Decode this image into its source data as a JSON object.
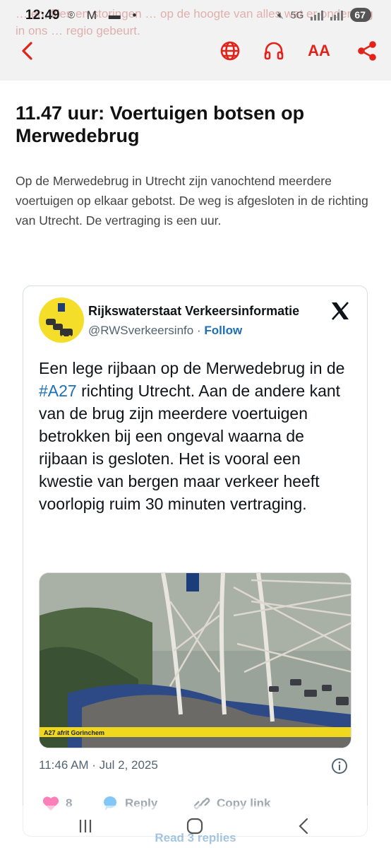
{
  "status_bar": {
    "time": "12:49",
    "network": "5G",
    "battery": "67"
  },
  "header": {
    "behind_text": "… en, files en storingen … op de hoogte van alles wat er onderweg in ons … regio gebeurt.",
    "icons": [
      "back-arrow-icon",
      "globe-icon",
      "headphones-icon",
      "font-size-icon",
      "share-icon"
    ],
    "font_size_label": "AA",
    "accent_color": "#e2231a"
  },
  "article": {
    "title": "11.47 uur: Voertuigen botsen op Merwedebrug",
    "body": "Op de Merwedebrug in Utrecht zijn vanochtend meerdere voertuigen op elkaar gebotst. De weg is afgesloten in de richting van Utrecht. De vertraging is een uur."
  },
  "tweet": {
    "author_name": "Rijkswaterstaat Verkeersinformatie",
    "handle": "@RWSverkeersinfo",
    "separator": "·",
    "follow_label": "Follow",
    "text_before": "Een lege rijbaan op de Merwedebrug in de ",
    "hashtag": "#A27",
    "text_after": " richting Utrecht. Aan de andere kant van de brug zijn meerdere voertuigen betrokken bij een ongeval waarna de rijbaan is gesloten. Het is vooral een kwestie van bergen maar verkeer heeft voorlopig ruim 30 minuten vertraging.",
    "image_caption": "A27 afrit Gorinchem",
    "timestamp": "11:46 AM · Jul 2, 2025",
    "likes": "8",
    "reply_label": "Reply",
    "copy_link_label": "Copy link",
    "read_replies_label": "Read 3 replies",
    "link_color": "#1d6fb8"
  },
  "navigation": {
    "buttons": [
      "recent-apps-icon",
      "home-icon",
      "back-icon"
    ]
  }
}
